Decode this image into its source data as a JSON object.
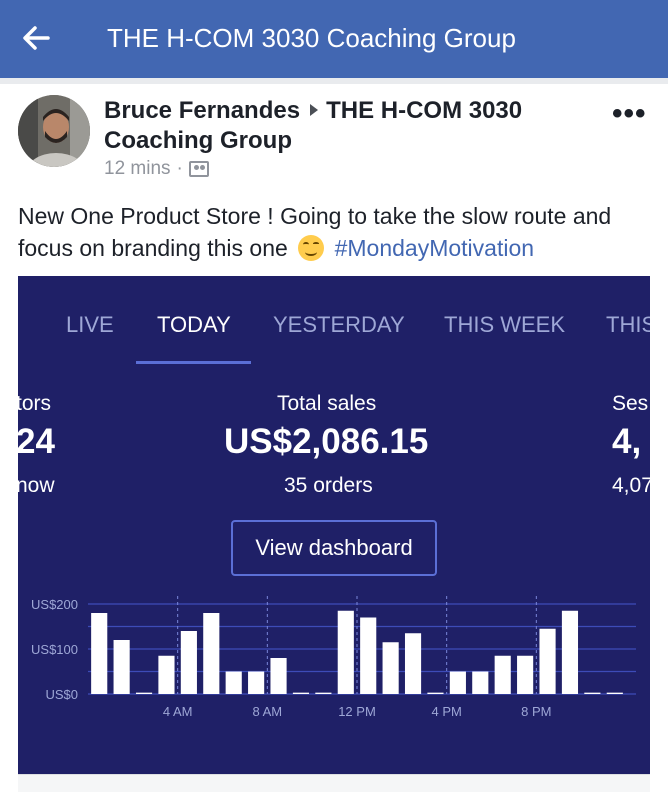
{
  "header": {
    "title": "THE H-COM 3030 Coaching Group",
    "back_icon": "back-arrow-icon",
    "bg_color": "#4267b2"
  },
  "post": {
    "author": "Bruce Fernandes",
    "group": "THE H-COM 3030 Coaching Group",
    "time": "12 mins",
    "dot": "·",
    "privacy_icon": "group-members-icon",
    "more_label": "•••",
    "text_before_emoji": "New One Product Store ! Going to take the slow route and focus on branding this one",
    "emoji_icon": "smiling-face-icon",
    "hashtag": "#MondayMotivation"
  },
  "dashboard": {
    "bg_color": "#1f2067",
    "tabs": [
      {
        "label": "LIVE",
        "active": false
      },
      {
        "label": "TODAY",
        "active": true
      },
      {
        "label": "YESTERDAY",
        "active": false
      },
      {
        "label": "THIS WEEK",
        "active": false
      },
      {
        "label": "THIS",
        "active": false
      }
    ],
    "stats": {
      "left": {
        "label": "tors",
        "value": "24",
        "sub": "now"
      },
      "center": {
        "label": "Total sales",
        "value": "US$2,086.15",
        "sub": "35 orders"
      },
      "right": {
        "label": "Ses",
        "value": "4,",
        "sub": "4,07"
      }
    },
    "view_button": "View dashboard"
  },
  "chart_data": {
    "type": "bar",
    "ylim": [
      0,
      200
    ],
    "y_ticks": [
      "US$200",
      "US$100",
      "US$0"
    ],
    "x_tick_labels": [
      "4 AM",
      "8 AM",
      "12 PM",
      "4 PM",
      "8 PM"
    ],
    "hours": [
      0,
      1,
      2,
      3,
      4,
      5,
      6,
      7,
      8,
      9,
      10,
      11,
      12,
      13,
      14,
      15,
      16,
      17,
      18,
      19,
      20,
      21,
      22,
      23
    ],
    "values": [
      180,
      120,
      3,
      85,
      140,
      180,
      50,
      50,
      80,
      3,
      3,
      185,
      170,
      115,
      135,
      3,
      50,
      50,
      85,
      85,
      145,
      185,
      3,
      3
    ],
    "bar_color": "#ffffff",
    "grid_color": "#3d4bb8"
  }
}
